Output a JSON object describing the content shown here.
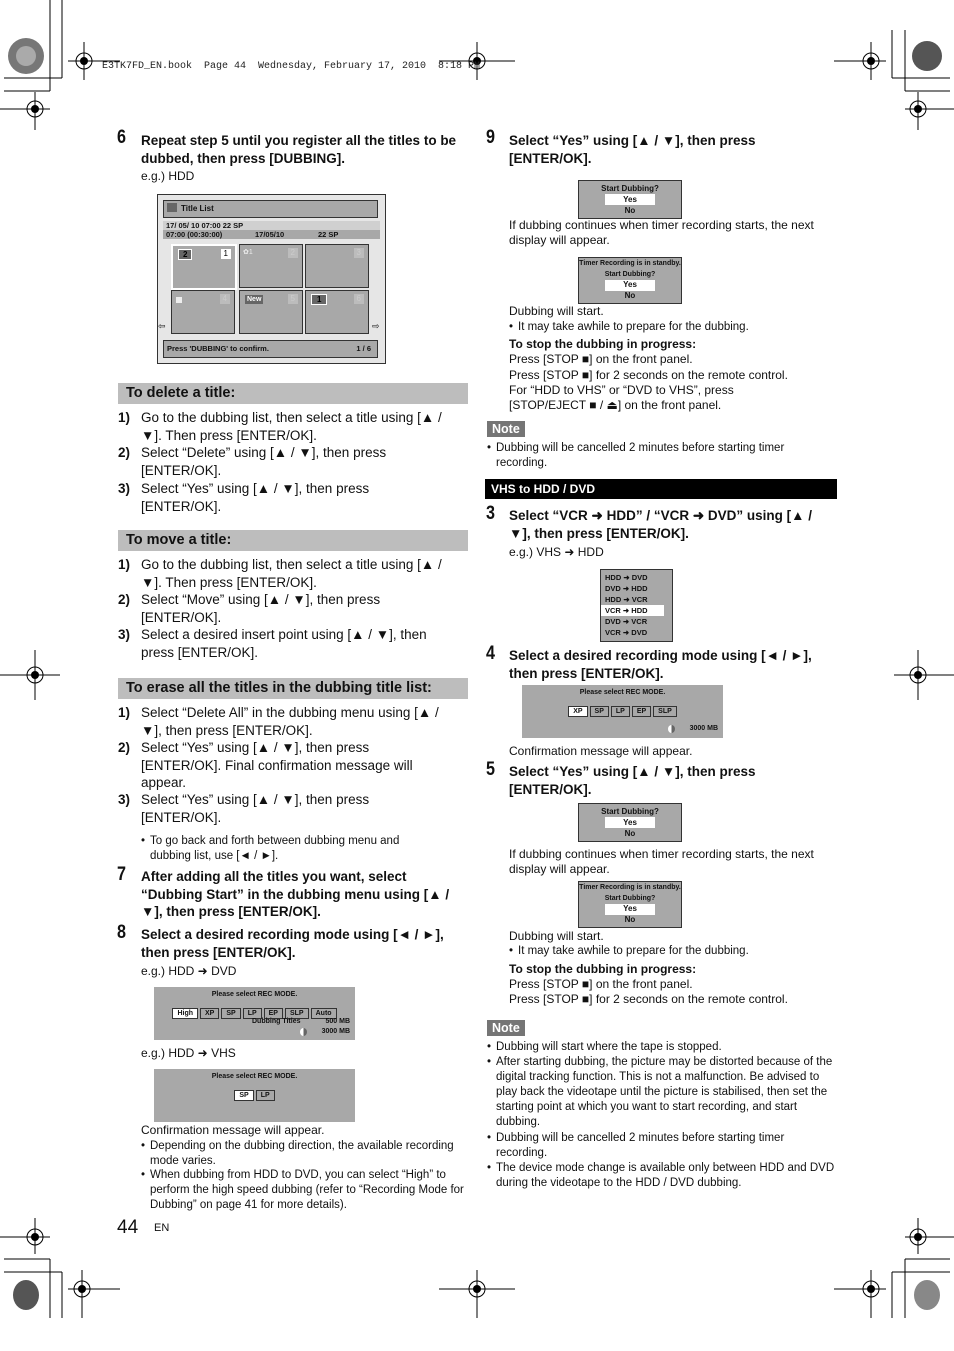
{
  "header": {
    "print_line": "E3TK7FD_EN.book  Page 44  Wednesday, February 17, 2010  8:18 PM"
  },
  "left": {
    "step6": {
      "num": "6",
      "text": "Repeat step 5 until you register all the titles to be dubbed, then press [DUBBING].",
      "eg": "e.g.) HDD"
    },
    "title_list_screen": {
      "title": "Title List",
      "info1": "17/ 05/ 10  07:00 22  SP",
      "info2_time": "07:00 (00:30:00)",
      "info2_date": "17/05/10",
      "info2_ch": "22   SP",
      "tiles": [
        {
          "num": "1",
          "badge": "2",
          "selected": true
        },
        {
          "num": "2",
          "badge": "icon"
        },
        {
          "num": "3",
          "badge": ""
        },
        {
          "num": "4",
          "badge": "lock"
        },
        {
          "num": "5",
          "badge": "New"
        },
        {
          "num": "6",
          "badge": "1"
        }
      ],
      "footer": "Press 'DUBBING' to confirm.",
      "page": "1 / 6"
    },
    "delete_section": {
      "heading": "To delete a title:",
      "items": [
        {
          "n": "1)",
          "text": "Go to the dubbing list, then select a title using [▲ / ▼]. Then press [ENTER/OK]."
        },
        {
          "n": "2)",
          "text": "Select “Delete” using [▲ / ▼], then press [ENTER/OK]."
        },
        {
          "n": "3)",
          "text": "Select “Yes” using [▲ / ▼], then press [ENTER/OK]."
        }
      ]
    },
    "move_section": {
      "heading": "To move a title:",
      "items": [
        {
          "n": "1)",
          "text": "Go to the dubbing list, then select a title using [▲ / ▼]. Then press [ENTER/OK]."
        },
        {
          "n": "2)",
          "text": "Select “Move” using [▲ / ▼], then press [ENTER/OK]."
        },
        {
          "n": "3)",
          "text": "Select a desired insert point using [▲ / ▼], then press [ENTER/OK]."
        }
      ]
    },
    "erase_section": {
      "heading": "To erase all the titles in the dubbing title list:",
      "items": [
        {
          "n": "1)",
          "text": "Select “Delete All” in the dubbing menu using [▲ / ▼], then press [ENTER/OK]."
        },
        {
          "n": "2)",
          "text": "Select “Yes” using [▲ / ▼], then press [ENTER/OK]. Final confirmation message will appear."
        },
        {
          "n": "3)",
          "text": "Select “Yes” using [▲ / ▼], then press [ENTER/OK]."
        }
      ],
      "bullet": "To go back and forth between dubbing menu and dubbing list, use [◄ / ►]."
    },
    "step7": {
      "num": "7",
      "text": "After adding all the titles you want, select “Dubbing Start” in the dubbing menu using [▲ / ▼], then press [ENTER/OK]."
    },
    "step8": {
      "num": "8",
      "text": "Select a desired recording mode using [◄ / ►], then press [ENTER/OK].",
      "eg1": "e.g.) HDD ➜ DVD",
      "screen1": {
        "title": "Please select REC MODE.",
        "modes": [
          "High",
          "XP",
          "SP",
          "LP",
          "EP",
          "SLP",
          "Auto"
        ],
        "selected": "High",
        "label": "Dubbing Titles",
        "size1": "500 MB",
        "size2": "3000 MB"
      },
      "eg2": "e.g.) HDD ➜ VHS",
      "screen2": {
        "title": "Please select REC MODE.",
        "modes": [
          "SP",
          "LP"
        ],
        "selected": "SP"
      },
      "confirm": "Confirmation message will appear.",
      "bullets": [
        "Depending on the dubbing direction, the available recording mode varies.",
        "When dubbing from HDD to DVD, you can select “High” to perform the high speed dubbing (refer to “Recording Mode for Dubbing” on page 41 for more details)."
      ]
    },
    "page_number": "44",
    "page_lang": "EN"
  },
  "right": {
    "step9": {
      "num": "9",
      "text": "Select “Yes” using [▲ / ▼], then press [ENTER/OK].",
      "dialog1": {
        "title": "Start Dubbing?",
        "yes": "Yes",
        "no": "No"
      },
      "timer_text": "If dubbing continues when timer recording starts, the next display will appear.",
      "dialog2": {
        "line1": "Timer Recording is in standby.",
        "title": "Start Dubbing?",
        "yes": "Yes",
        "no": "No"
      },
      "will_start": "Dubbing will start.",
      "bullet": "It may take awhile to prepare for the dubbing.",
      "stop_heading": "To stop the dubbing in progress:",
      "stop1": "Press [STOP ■] on the front panel.",
      "stop2": "Press [STOP ■] for 2 seconds on the remote control.",
      "stop3": "For “HDD to VHS” or “DVD to VHS”, press",
      "stop4": "[STOP/EJECT ■ / ⏏] on the front panel."
    },
    "note1": {
      "label": "Note",
      "items": [
        "Dubbing will be cancelled 2 minutes before starting timer recording."
      ]
    },
    "vhs_bar": "VHS to HDD / DVD",
    "step3": {
      "num": "3",
      "text": "Select “VCR ➜ HDD” / “VCR ➜ DVD” using [▲ / ▼], then press [ENTER/OK].",
      "eg": "e.g.) VHS ➜ HDD",
      "menu": [
        "HDD ➜ DVD",
        "DVD ➜ HDD",
        "HDD ➜ VCR",
        "VCR ➜ HDD",
        "DVD ➜ VCR",
        "VCR ➜ DVD"
      ],
      "menu_selected": 3
    },
    "step4": {
      "num": "4",
      "text": "Select a desired recording mode using [◄ / ►], then press [ENTER/OK].",
      "screen": {
        "title": "Please select REC MODE.",
        "modes": [
          "XP",
          "SP",
          "LP",
          "EP",
          "SLP"
        ],
        "selected": "XP",
        "size": "3000 MB"
      },
      "confirm": "Confirmation message will appear."
    },
    "step5": {
      "num": "5",
      "text": "Select “Yes” using [▲ / ▼], then press [ENTER/OK].",
      "dialog1": {
        "title": "Start Dubbing?",
        "yes": "Yes",
        "no": "No"
      },
      "timer_text": "If dubbing continues when timer recording starts, the next display will appear.",
      "dialog2": {
        "line1": "Timer Recording is in standby.",
        "title": "Start Dubbing?",
        "yes": "Yes",
        "no": "No"
      },
      "will_start": "Dubbing will start.",
      "bullet": "It may take awhile to prepare for the dubbing.",
      "stop_heading": "To stop the dubbing in progress:",
      "stop1": "Press [STOP ■] on the front panel.",
      "stop2": "Press [STOP ■] for 2 seconds on the remote control."
    },
    "note2": {
      "label": "Note",
      "items": [
        "Dubbing will start where the tape is stopped.",
        "After starting dubbing, the picture may be distorted because of the digital tracking function. This is not a malfunction. Be advised to play back the videotape until the picture is stabilised, then set the starting point at which you want to start recording, and start dubbing.",
        "Dubbing will be cancelled 2 minutes before starting timer recording.",
        "The device mode change is available only between HDD and DVD during the videotape to the HDD / DVD dubbing."
      ]
    }
  }
}
